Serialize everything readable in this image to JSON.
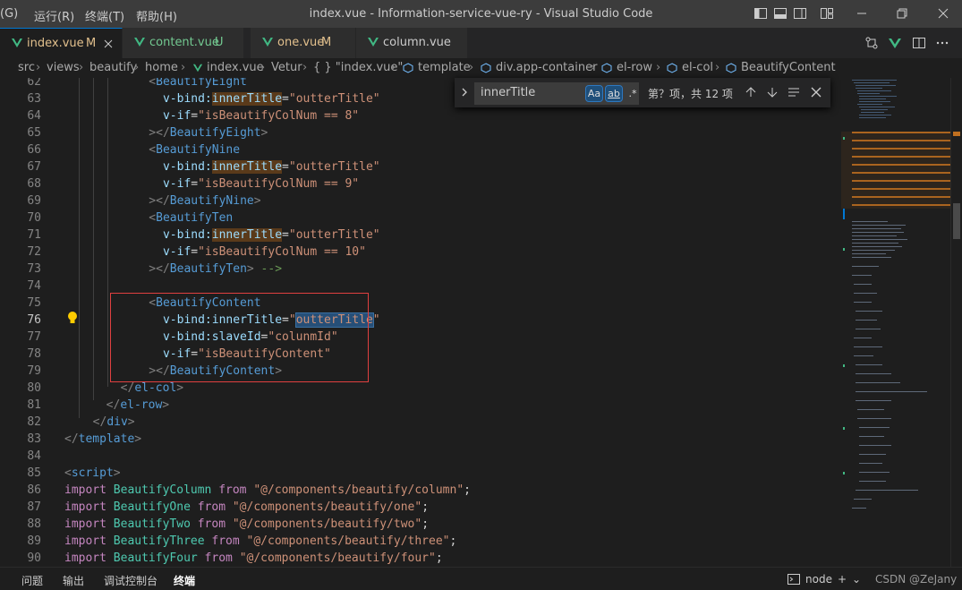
{
  "window": {
    "title": "index.vue - Information-service-vue-ry - Visual Studio Code",
    "menu": [
      "(G)",
      "运行(R)",
      "终端(T)",
      "帮助(H)"
    ]
  },
  "tabs": [
    {
      "name": "index.vue",
      "status": "M"
    },
    {
      "name": "content.vue",
      "status": "U"
    },
    {
      "name": "one.vue",
      "status": "M"
    },
    {
      "name": "column.vue",
      "status": ""
    }
  ],
  "breadcrumb": [
    "src",
    "views",
    "beautify",
    "home",
    "index.vue",
    "Vetur",
    "{ } \"index.vue\"",
    "template",
    "div.app-container",
    "el-row",
    "el-col",
    "BeautifyContent"
  ],
  "find": {
    "query": "innerTitle",
    "opt_case": "Aa",
    "opt_word": "ab",
    "opt_regex": ".*",
    "result": "第？项，共 12 项"
  },
  "lines": [
    {
      "n": "62",
      "html": "<span class=\"tg\">    &lt;</span><span class=\"tn\">BeautifyEight</span>"
    },
    {
      "n": "63",
      "html": "      <span class=\"at\">v-bind:</span><span class=\"at hl\">innerTitle</span><span class=\"pl\">=</span><span class=\"st2\">\"outterTitle\"</span>"
    },
    {
      "n": "64",
      "html": "      <span class=\"at\">v-if</span><span class=\"pl\">=</span><span class=\"st2\">\"isBeautifyColNum == 8\"</span>"
    },
    {
      "n": "65",
      "html": "<span class=\"tg\">    &gt;&lt;/</span><span class=\"tn\">BeautifyEight</span><span class=\"tg\">&gt;</span>"
    },
    {
      "n": "66",
      "html": "<span class=\"tg\">    &lt;</span><span class=\"tn\">BeautifyNine</span>"
    },
    {
      "n": "67",
      "html": "      <span class=\"at\">v-bind:</span><span class=\"at hl\">innerTitle</span><span class=\"pl\">=</span><span class=\"st2\">\"outterTitle\"</span>"
    },
    {
      "n": "68",
      "html": "      <span class=\"at\">v-if</span><span class=\"pl\">=</span><span class=\"st2\">\"isBeautifyColNum == 9\"</span>"
    },
    {
      "n": "69",
      "html": "<span class=\"tg\">    &gt;&lt;/</span><span class=\"tn\">BeautifyNine</span><span class=\"tg\">&gt;</span>"
    },
    {
      "n": "70",
      "html": "<span class=\"tg\">    &lt;</span><span class=\"tn\">BeautifyTen</span>"
    },
    {
      "n": "71",
      "html": "      <span class=\"at\">v-bind:</span><span class=\"at hl\">innerTitle</span><span class=\"pl\">=</span><span class=\"st2\">\"outterTitle\"</span>"
    },
    {
      "n": "72",
      "html": "      <span class=\"at\">v-if</span><span class=\"pl\">=</span><span class=\"st2\">\"isBeautifyColNum == 10\"</span>"
    },
    {
      "n": "73",
      "html": "<span class=\"tg\">    &gt;&lt;/</span><span class=\"tn\">BeautifyTen</span><span class=\"tg\">&gt;</span><span class=\"cm\"> --&gt;</span>"
    },
    {
      "n": "74",
      "html": ""
    },
    {
      "n": "75",
      "html": "<span class=\"tg\">    &lt;</span><span class=\"tn\">BeautifyContent</span>"
    },
    {
      "n": "76",
      "html": "      <span class=\"at\">v-bind:</span><span class=\"at\">innerTitle</span><span class=\"pl\">=</span><span class=\"st2\">\"<span class=\"sel\">outterTitle</span>\"</span>"
    },
    {
      "n": "77",
      "html": "      <span class=\"at\">v-bind:slaveId</span><span class=\"pl\">=</span><span class=\"st2\">\"colunmId\"</span>"
    },
    {
      "n": "78",
      "html": "      <span class=\"at\">v-if</span><span class=\"pl\">=</span><span class=\"st2\">\"isBeautifyContent\"</span>"
    },
    {
      "n": "79",
      "html": "<span class=\"tg\">    &gt;&lt;/</span><span class=\"tn\">BeautifyContent</span><span class=\"tg\">&gt;</span>"
    },
    {
      "n": "80",
      "html": "<span class=\"tg\">  &lt;/</span><span class=\"tn\">el-col</span><span class=\"tg\">&gt;</span>"
    },
    {
      "n": "81",
      "html": "<span class=\"tg\">  &lt;/</span><span class=\"tn\">el-row</span><span class=\"tg\">&gt;</span>"
    },
    {
      "n": "82",
      "html": "<span class=\"tg\">  &lt;/</span><span class=\"tn\">div</span><span class=\"tg\">&gt;</span>"
    },
    {
      "n": "83",
      "html": "<span class=\"tg\">&lt;/</span><span class=\"tn\">template</span><span class=\"tg\">&gt;</span>"
    },
    {
      "n": "84",
      "html": ""
    },
    {
      "n": "85",
      "html": "<span class=\"tg\">&lt;</span><span class=\"tn\">script</span><span class=\"tg\">&gt;</span>"
    },
    {
      "n": "86",
      "html": "<span class=\"kw\">import</span> <span class=\"cl\">BeautifyColumn</span> <span class=\"kw\">from</span> <span class=\"st2\">\"@/components/beautify/column\"</span><span class=\"pl\">;</span>"
    },
    {
      "n": "87",
      "html": "<span class=\"kw\">import</span> <span class=\"cl\">BeautifyOne</span> <span class=\"kw\">from</span> <span class=\"st2\">\"@/components/beautify/one\"</span><span class=\"pl\">;</span>"
    },
    {
      "n": "88",
      "html": "<span class=\"kw\">import</span> <span class=\"cl\">BeautifyTwo</span> <span class=\"kw\">from</span> <span class=\"st2\">\"@/components/beautify/two\"</span><span class=\"pl\">;</span>"
    },
    {
      "n": "89",
      "html": "<span class=\"kw\">import</span> <span class=\"cl\">BeautifyThree</span> <span class=\"kw\">from</span> <span class=\"st2\">\"@/components/beautify/three\"</span><span class=\"pl\">;</span>"
    },
    {
      "n": "90",
      "html": "<span class=\"kw\">import</span> <span class=\"cl\">BeautifyFour</span> <span class=\"kw\">from</span> <span class=\"st2\">\"@/components/beautify/four\"</span><span class=\"pl\">;</span>"
    }
  ],
  "panel": {
    "tabs": [
      "问题",
      "输出",
      "调试控制台",
      "终端"
    ],
    "terminal": "node",
    "watermark": "CSDN @ZeJany"
  },
  "colors": {
    "accent": "#0078d4",
    "modified": "#e2c08d",
    "untracked": "#73c991",
    "vue_icon": "#41b883"
  }
}
